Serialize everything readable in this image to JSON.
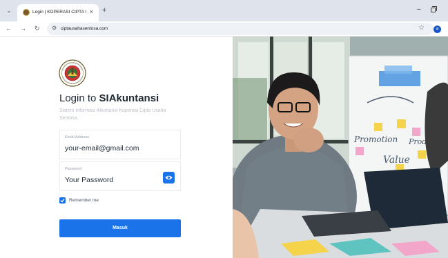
{
  "browser": {
    "tab_title": "Login | KOPERASI CIPTA USAHA",
    "tab_close": "×",
    "new_tab": "+",
    "url": "ciptausahasentosa.com",
    "profile_initial": "a"
  },
  "login": {
    "title_prefix": "Login to ",
    "title_app": "SIAkuntansi",
    "subtitle": "Sistem Informasi Akuntansi Koperasi Cipta Usaha Sentosa.",
    "email_label": "Email Address",
    "email_value": "your-email@gmail.com",
    "password_label": "Password",
    "password_value": "Your Password",
    "remember_label": "Remember me",
    "remember_checked": true,
    "submit_label": "Masuk"
  },
  "photo": {
    "whiteboard_text": [
      "Promotion",
      "Product",
      "Value"
    ]
  },
  "colors": {
    "accent": "#1a73e8",
    "tabstrip": "#dfe3eb"
  }
}
